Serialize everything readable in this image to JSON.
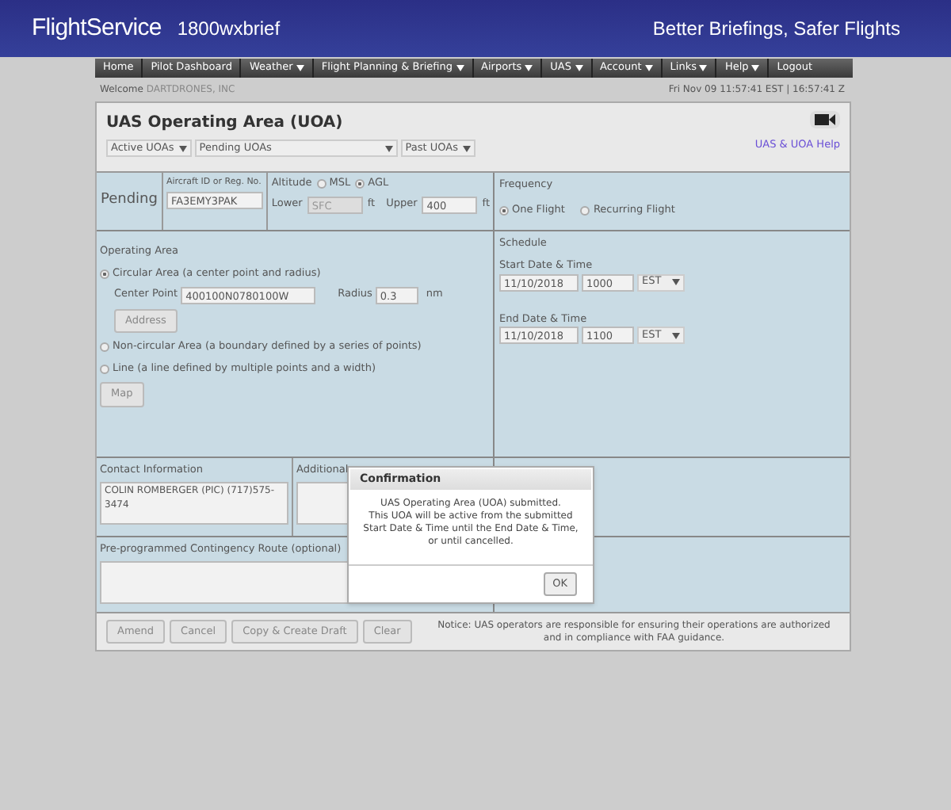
{
  "header": {
    "logo": "FlightService",
    "phone": "1800wxbrief",
    "tagline": "Better Briefings, Safer Flights"
  },
  "nav": [
    {
      "label": "Home",
      "dropdown": false
    },
    {
      "label": "Pilot Dashboard",
      "dropdown": false
    },
    {
      "label": "Weather",
      "dropdown": true
    },
    {
      "label": "Flight Planning & Briefing",
      "dropdown": true
    },
    {
      "label": "Airports",
      "dropdown": true
    },
    {
      "label": "UAS",
      "dropdown": true
    },
    {
      "label": "Account",
      "dropdown": true
    },
    {
      "label": "Links",
      "dropdown": true
    },
    {
      "label": "Help",
      "dropdown": true
    },
    {
      "label": "Logout",
      "dropdown": false
    }
  ],
  "welcome": {
    "label": "Welcome",
    "user": "DARTDRONES, INC"
  },
  "clock": "Fri Nov 09 11:57:41 EST | 16:57:41 Z",
  "page": {
    "title": "UAS Operating Area (UOA)",
    "help_link": "UAS & UOA Help"
  },
  "uoa_lists": [
    {
      "label": "Active UOAs"
    },
    {
      "label": "Pending UOAs"
    },
    {
      "label": "Past UOAs"
    }
  ],
  "status": "Pending",
  "aircraft": {
    "label": "Aircraft ID or Reg. No.",
    "value": "FA3EMY3PAK"
  },
  "altitude": {
    "label": "Altitude",
    "references": [
      {
        "label": "MSL",
        "selected": false
      },
      {
        "label": "AGL",
        "selected": true
      }
    ],
    "lower": {
      "label": "Lower",
      "value": "SFC",
      "unit": "ft",
      "disabled": true
    },
    "upper": {
      "label": "Upper",
      "value": "400",
      "unit": "ft",
      "disabled": false
    }
  },
  "frequency": {
    "label": "Frequency",
    "options": [
      {
        "label": "One Flight",
        "selected": true
      },
      {
        "label": "Recurring Flight",
        "selected": false
      }
    ]
  },
  "operating_area": {
    "label": "Operating Area",
    "options": [
      {
        "label": "Circular Area (a center point and radius)",
        "selected": true
      },
      {
        "label": "Non-circular Area (a boundary defined by a series of points)",
        "selected": false
      },
      {
        "label": "Line (a line defined by multiple points and a width)",
        "selected": false
      }
    ],
    "center_point": {
      "label": "Center Point",
      "value": "400100N0780100W"
    },
    "radius": {
      "label": "Radius",
      "value": "0.3",
      "unit": "nm"
    },
    "address_button": "Address",
    "map_button": "Map"
  },
  "schedule": {
    "label": "Schedule",
    "times": [
      {
        "label": "Start Date & Time",
        "date": "11/10/2018",
        "time": "1000",
        "zone": "EST"
      },
      {
        "label": "End Date & Time",
        "date": "11/10/2018",
        "time": "1100",
        "zone": "EST"
      }
    ]
  },
  "contact": {
    "label": "Contact Information",
    "value": "COLIN ROMBERGER (PIC) (717)575-3474"
  },
  "additional": {
    "label": "Additional"
  },
  "contingency": {
    "label": "Pre-programmed Contingency Route (optional)"
  },
  "actions": [
    "Amend",
    "Cancel",
    "Copy & Create Draft",
    "Clear"
  ],
  "notice": "Notice: UAS operators are responsible for ensuring their operations are authorized and in compliance with FAA guidance.",
  "dialog": {
    "title": "Confirmation",
    "message": "UAS Operating Area (UOA) submitted.\nThis UOA will be active from the submitted\nStart Date & Time until the End Date & Time,\nor until cancelled.",
    "button": "OK"
  }
}
